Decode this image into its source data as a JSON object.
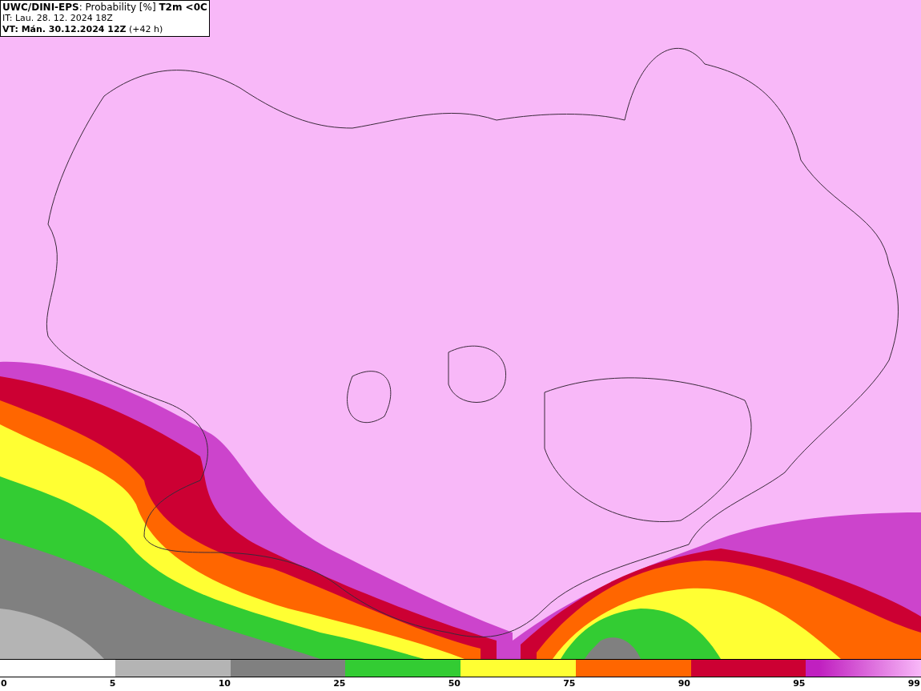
{
  "header": {
    "title": "**UWC/DINI-EPS**: Probability [%] **T2m <0C**",
    "init_time": "IT: Lau. 28. 12. 2024 18Z",
    "valid_time": "**VT: Mán. 30.12.2024 12Z** (+42 h)"
  },
  "legend": {
    "segments": [
      {
        "color": "#b4b4b4"
      },
      {
        "color": "#808080"
      },
      {
        "color": "#33cc33"
      },
      {
        "color": "#ffff33"
      },
      {
        "color": "#ff6600"
      },
      {
        "color": "#cc0033"
      },
      {
        "color": "#c020c0"
      }
    ],
    "labels": [
      "0",
      "5",
      "10",
      "25",
      "50",
      "75",
      "90",
      "95",
      "99"
    ]
  }
}
